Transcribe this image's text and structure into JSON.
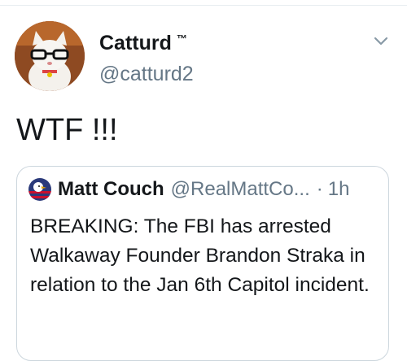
{
  "tweet": {
    "author": {
      "display_name": "Catturd",
      "badge": "™",
      "handle": "@catturd2",
      "avatar_icon": "cat-with-glasses-avatar"
    },
    "text": "WTF !!!",
    "menu_icon": "chevron-down-icon"
  },
  "quoted_tweet": {
    "author": {
      "display_name": "Matt Couch",
      "handle": "@RealMattCo...",
      "avatar_icon": "eagle-flag-avatar"
    },
    "separator": "·",
    "time": "1h",
    "text": "BREAKING: The FBI has arrested Walkaway Founder Brandon Straka in relation to the Jan 6th Capitol incident."
  },
  "colors": {
    "primary_text": "#14171a",
    "secondary_text": "#657786",
    "border": "#ccd6dd"
  }
}
